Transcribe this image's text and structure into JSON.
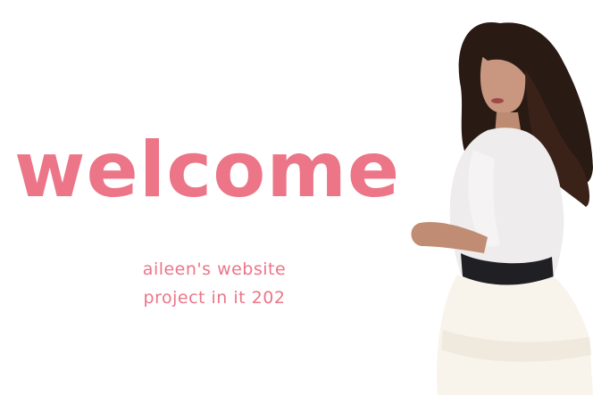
{
  "hero": {
    "title": "welcome",
    "subtitle_line1": "aileen's website",
    "subtitle_line2": "project in it 202"
  },
  "colors": {
    "accent": "#ec7588",
    "background": "#ffffff"
  },
  "image": {
    "icon": "portrait-photo"
  }
}
